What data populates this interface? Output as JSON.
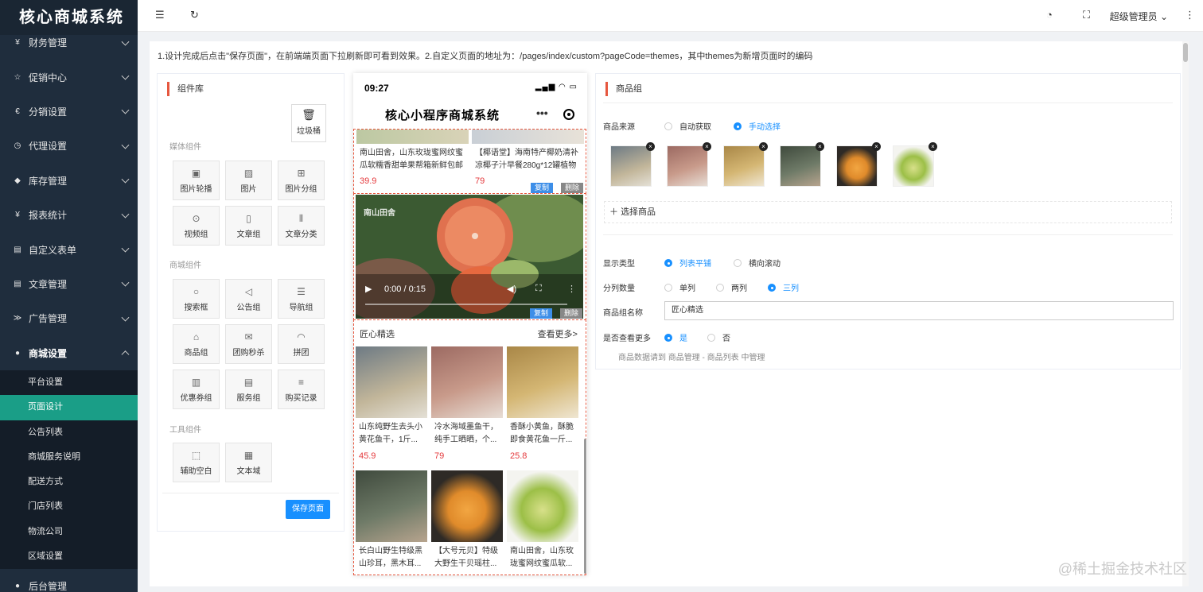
{
  "app": {
    "logo": "核心商城系统"
  },
  "sidebar": {
    "items": [
      {
        "label": "财务管理",
        "icon": "¥"
      },
      {
        "label": "促销中心",
        "icon": "☆"
      },
      {
        "label": "分销设置",
        "icon": "€"
      },
      {
        "label": "代理设置",
        "icon": "◷"
      },
      {
        "label": "库存管理",
        "icon": "◆"
      },
      {
        "label": "报表统计",
        "icon": "¥"
      },
      {
        "label": "自定义表单",
        "icon": "▤"
      },
      {
        "label": "文章管理",
        "icon": "▤"
      },
      {
        "label": "广告管理",
        "icon": "≫"
      },
      {
        "label": "商城设置",
        "icon": "●"
      }
    ],
    "sub_items": [
      "平台设置",
      "页面设计",
      "公告列表",
      "商城服务说明",
      "配送方式",
      "门店列表",
      "物流公司",
      "区域设置"
    ],
    "bottom_item": "后台管理"
  },
  "topbar": {
    "user": "超级管理员"
  },
  "notice": "1.设计完成后点击\"保存页面\"，在前端端页面下拉刷新即可看到效果。2.自定义页面的地址为：/pages/index/custom?pageCode=themes，其中themes为新增页面时的编码",
  "library": {
    "title": "组件库",
    "trash": "垃圾桶",
    "sections": {
      "media": "媒体组件",
      "mall": "商城组件",
      "tools": "工具组件"
    },
    "media": [
      "图片轮播",
      "图片",
      "图片分组",
      "视频组",
      "文章组",
      "文章分类"
    ],
    "mall": [
      "搜索框",
      "公告组",
      "导航组",
      "商品组",
      "团购秒杀",
      "拼团",
      "优惠券组",
      "服务组",
      "购买记录"
    ],
    "tools": [
      "辅助空白",
      "文本域"
    ],
    "save": "保存页面"
  },
  "phone": {
    "time": "09:27",
    "title": "核心小程序商城系统",
    "top_products": [
      {
        "name": "南山田舍，山东玫珑蜜网纹蜜瓜软糯香甜单果帮箱新鲜包邮",
        "price": "39.9"
      },
      {
        "name": "【椰语堂】海南特产椰奶清补凉椰子汁早餐280g*12罐植物",
        "price": "79"
      }
    ],
    "copy": "复制",
    "delete": "删除",
    "video": {
      "watermark": "南山田舍",
      "time": "0:00 / 0:15"
    },
    "group_title": "匠心精选",
    "more": "查看更多>",
    "products": [
      {
        "name": "山东纯野生去头小黄花鱼干，1斤...",
        "price": "45.9"
      },
      {
        "name": "冷水海域墨鱼干，纯手工晒晒，个...",
        "price": "79"
      },
      {
        "name": "香酥小黄鱼，酥脆即食黄花鱼一斤...",
        "price": "25.8"
      },
      {
        "name": "长白山野生特级黑山珍耳，黑木耳...",
        "price": ""
      },
      {
        "name": "【大号元贝】特级大野生干贝瑶柱...",
        "price": ""
      },
      {
        "name": "南山田舍，山东玫珑蜜网纹蜜瓜软...",
        "price": ""
      }
    ]
  },
  "settings": {
    "title": "商品组",
    "source_label": "商品来源",
    "source_auto": "自动获取",
    "source_manual": "手动选择",
    "choose": "选择商品",
    "display_label": "显示类型",
    "display_list": "列表平铺",
    "display_scroll": "横向滚动",
    "cols_label": "分列数量",
    "cols_1": "单列",
    "cols_2": "两列",
    "cols_3": "三列",
    "name_label": "商品组名称",
    "name_value": "匠心精选",
    "more_label": "是否查看更多",
    "more_yes": "是",
    "more_no": "否",
    "hint": "商品数据请到 商品管理 - 商品列表 中管理"
  },
  "watermark": "@稀土掘金技术社区",
  "colors": {
    "sidebar": "#1f2d3d",
    "active": "#1a9e87",
    "accent": "#1890ff",
    "price": "#e4393c",
    "title_bar": "#e6573f"
  }
}
